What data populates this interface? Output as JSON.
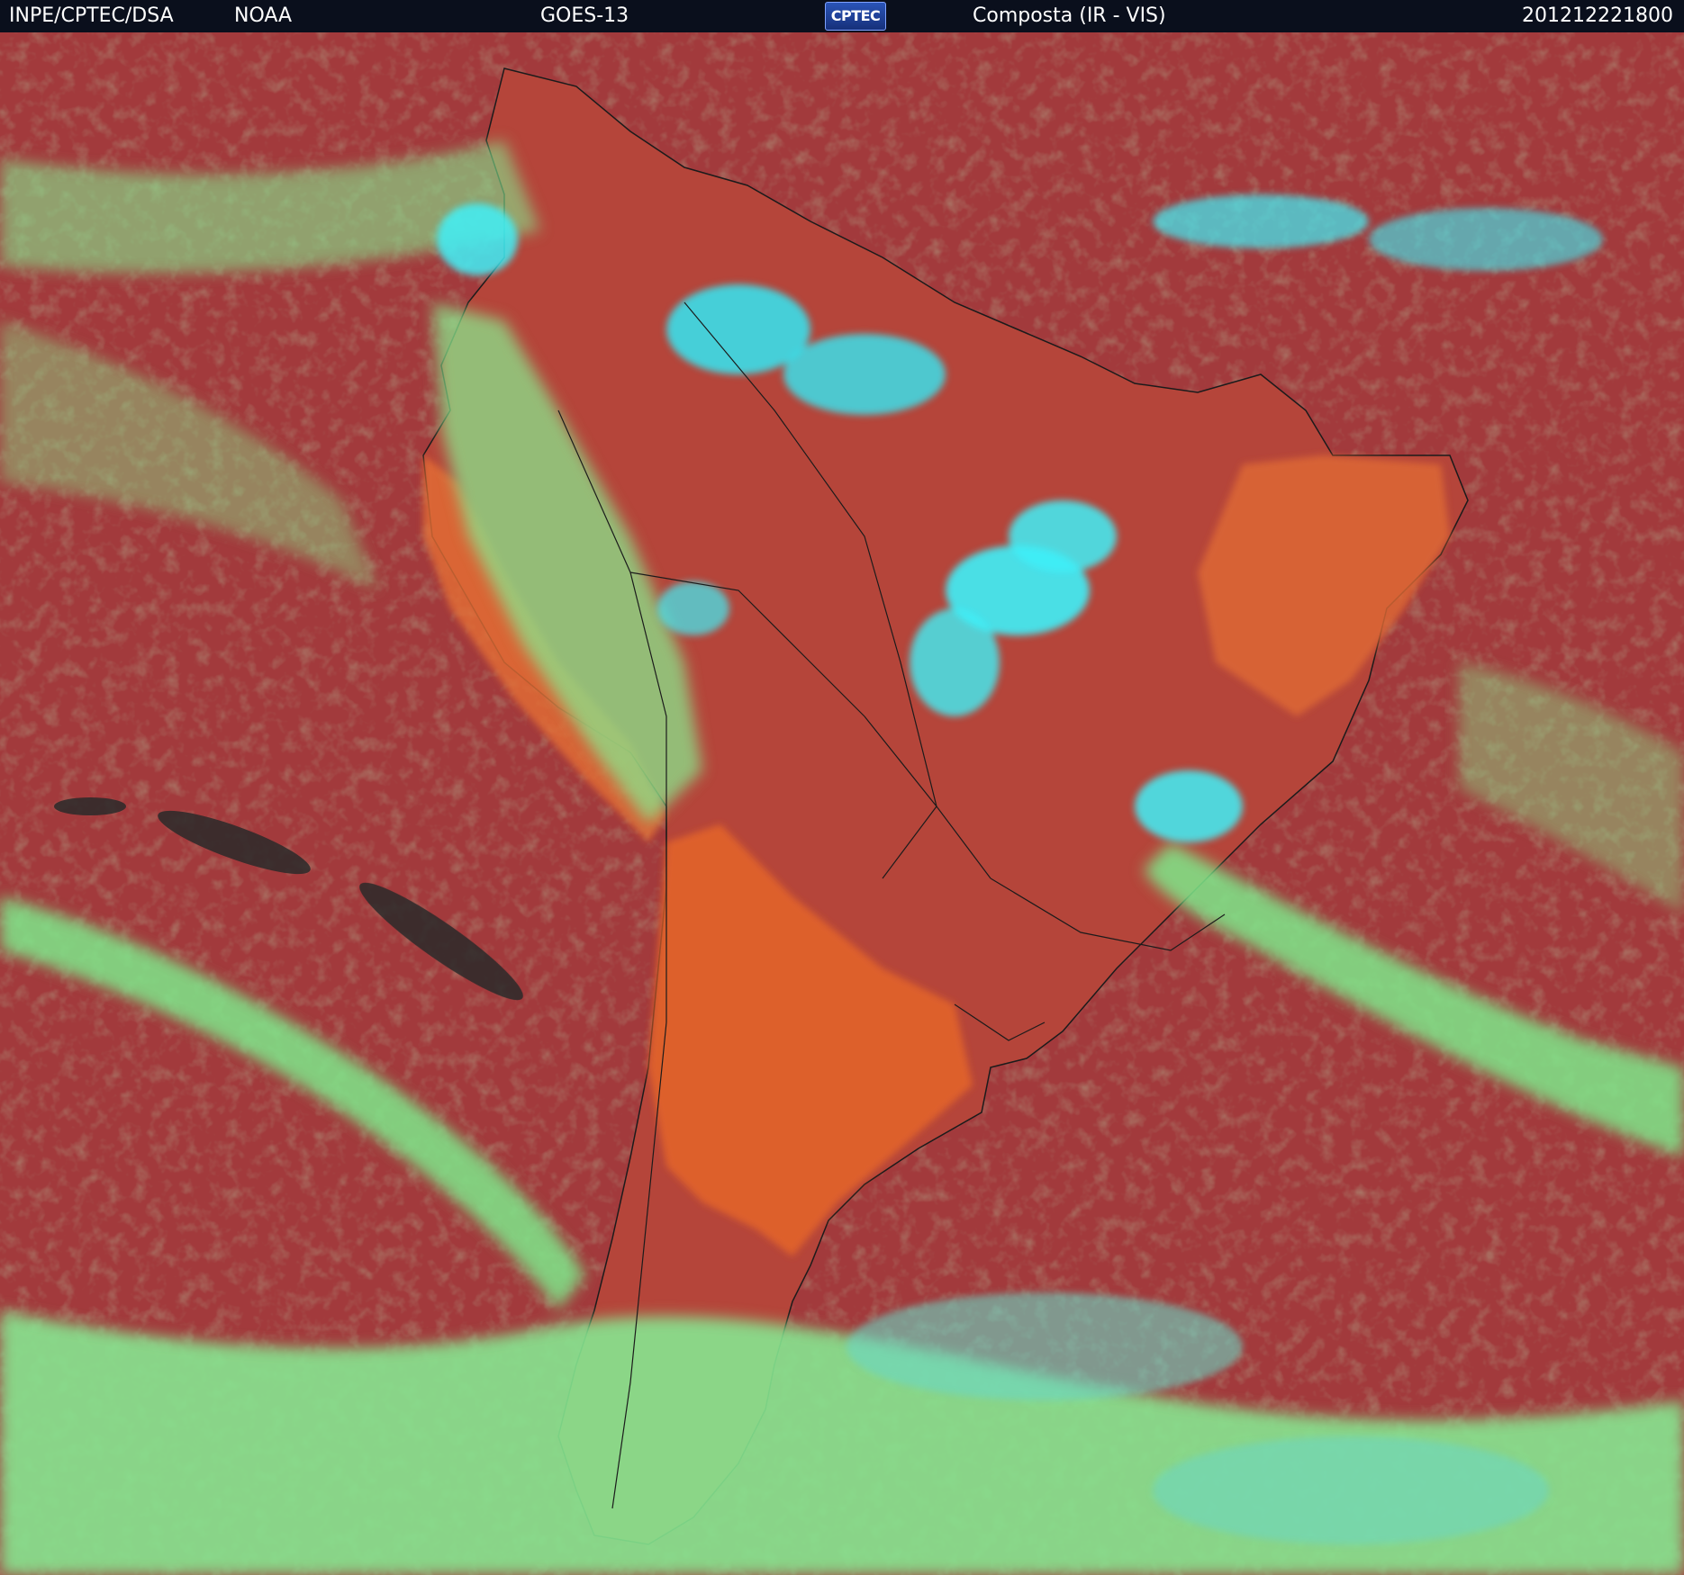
{
  "header": {
    "agency": "INPE/CPTEC/DSA",
    "partner": "NOAA",
    "satellite": "GOES-13",
    "logo_text": "CPTEC",
    "product": "Composta (IR - VIS)",
    "timestamp": "201212221800"
  },
  "colors": {
    "ocean": "#a23a3c",
    "land_dry": "#e0602a",
    "cloud_low": "#7ee88a",
    "cloud_high": "#33e8f5",
    "cloud_cold": "#6ad7c4",
    "borders": "#1b1b1b",
    "header_bg": "#0a0f1c"
  }
}
